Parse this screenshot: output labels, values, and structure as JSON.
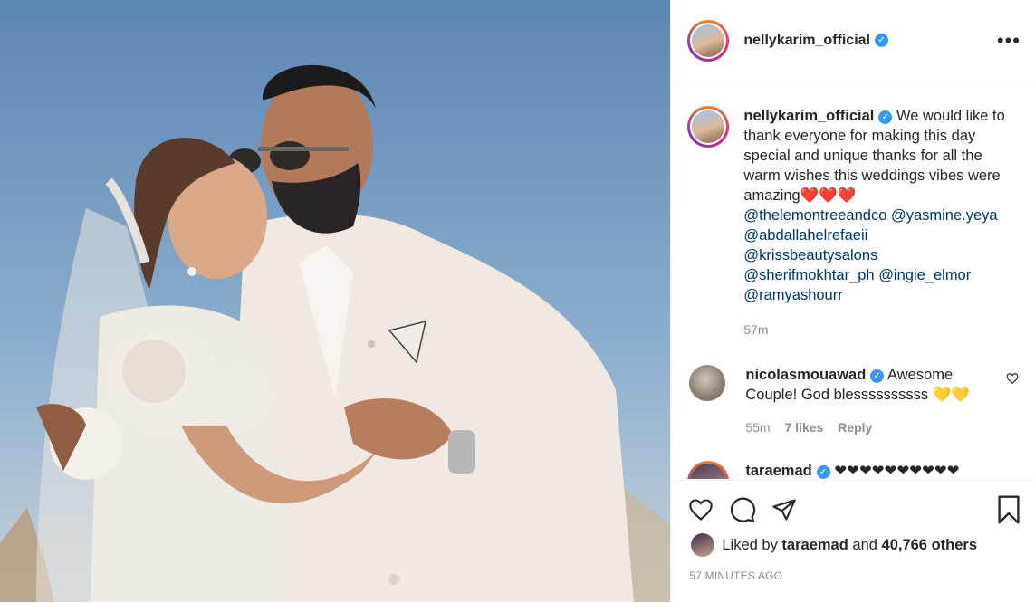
{
  "post": {
    "username": "nellykarim_official",
    "verified": "✓",
    "more_icon": "•••",
    "caption": {
      "username": "nellykarim_official",
      "text": "We would like to thank everyone for making this day special and unique thanks for all the warm wishes this weddings vibes were amazing",
      "hearts": "❤️❤️❤️",
      "mentions": [
        "@thelemontreeandco",
        "@yasmine.yeya",
        "@abdallahelrefaeii",
        "@krissbeautysalons",
        "@sherifmokhtar_ph",
        "@ingie_elmor",
        "@ramyashourr"
      ],
      "time": "57m"
    },
    "comments": [
      {
        "username": "nicolasmouawad",
        "text": "Awesome Couple! God blessssssssss",
        "emoji": "💛💛",
        "time": "55m",
        "likes": "7 likes",
        "reply": "Reply"
      },
      {
        "username": "taraemad",
        "text": "❤❤❤❤❤❤❤❤❤❤"
      }
    ],
    "liked_by_prefix": "Liked by",
    "liked_by_user": "taraemad",
    "liked_by_and": "and",
    "liked_by_others": "40,766 others",
    "posted_ago": "57 MINUTES AGO"
  },
  "colors": {
    "accent": "#3897f0",
    "mention": "#00376b",
    "muted": "#8e8e8e"
  },
  "icons": [
    "heart-icon",
    "comment-icon",
    "share-icon",
    "bookmark-icon",
    "more-icon",
    "verified-icon"
  ]
}
